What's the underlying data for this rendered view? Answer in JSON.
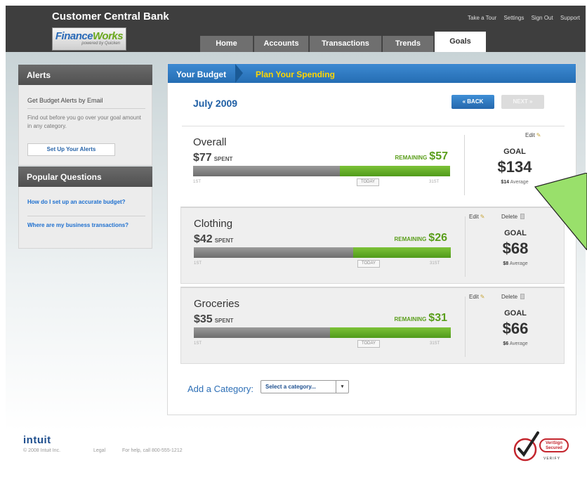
{
  "header": {
    "bank_name": "Customer Central Bank",
    "logo_word_1": "Finance",
    "logo_word_2": "Works",
    "logo_sub": "powered by Quicken",
    "top_links": [
      "Take a Tour",
      "Settings",
      "Sign Out",
      "Support"
    ],
    "tabs": [
      "Home",
      "Accounts",
      "Transactions",
      "Trends",
      "Goals"
    ],
    "active_tab": "Goals"
  },
  "sidebar": {
    "alerts": {
      "title": "Alerts",
      "subtitle": "Get Budget Alerts by Email",
      "description": "Find out before you go over your goal amount in any category.",
      "button": "Set Up Your Alerts"
    },
    "popular_questions": {
      "title": "Popular Questions",
      "items": [
        "How do I set up an accurate budget?",
        "Where are my business transactions?"
      ]
    }
  },
  "main": {
    "breadcrumb": [
      "Your Budget",
      "Plan Your Spending"
    ],
    "month": "July 2009",
    "back_label": "« BACK",
    "next_label": "NEXT »",
    "spent_label": "SPENT",
    "remaining_label": "REMAINING",
    "goal_label": "GOAL",
    "average_label": "Average",
    "today_label": "TODAY",
    "tick_start": "1ST",
    "tick_end": "31ST",
    "edit_label": "Edit",
    "delete_label": "Delete",
    "categories": [
      {
        "name": "Overall",
        "spent": "$77",
        "remaining": "$57",
        "goal": "$134",
        "average": "$14",
        "spent_fraction": 0.57,
        "deletable": false
      },
      {
        "name": "Clothing",
        "spent": "$42",
        "remaining": "$26",
        "goal": "$68",
        "average": "$8",
        "spent_fraction": 0.62,
        "deletable": true
      },
      {
        "name": "Groceries",
        "spent": "$35",
        "remaining": "$31",
        "goal": "$66",
        "average": "$6",
        "spent_fraction": 0.53,
        "deletable": true
      }
    ],
    "add_category_label": "Add a Category:",
    "select_placeholder": "Select a category...",
    "select_arrow": "▾"
  },
  "footer": {
    "logo": "intuit",
    "copyright": "© 2008 Intuit Inc.",
    "legal": "Legal",
    "help": "For help, call 800-555-1212",
    "verisign_line1": "VeriSign",
    "verisign_line2": "Secured",
    "verisign_verify": "VERIFY"
  },
  "colors": {
    "header_bg": "#3e3e3e",
    "accent_blue": "#2a75c0",
    "remaining_green": "#5a9e1b",
    "callout_green": "#99e06b"
  }
}
